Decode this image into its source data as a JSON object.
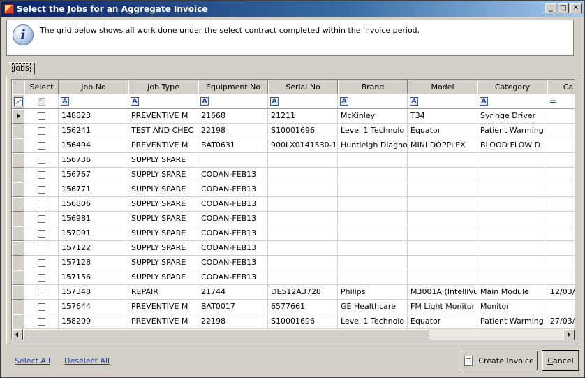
{
  "window": {
    "title": "Select the Jobs for an Aggregate Invoice",
    "controls": {
      "minimize": "_",
      "maximize": "□",
      "close": "✕"
    }
  },
  "info": {
    "icon": "info-icon",
    "text": "The grid below shows all work done under the select contract completed within the invoice period."
  },
  "tabs": [
    {
      "label": "Jobs"
    }
  ],
  "grid": {
    "columns": [
      "Select",
      "Job No",
      "Job Type",
      "Equipment No",
      "Serial No",
      "Brand",
      "Model",
      "Category",
      "Ca"
    ],
    "filter_operators": {
      "text": "A",
      "equals": "="
    },
    "rows": [
      {
        "current": true,
        "job_no": "148823",
        "job_type": "PREVENTIVE M",
        "equipment_no": "21668",
        "serial_no": "21211",
        "brand": "McKinley",
        "model": "T34",
        "category": "Syringe Driver",
        "ca": ""
      },
      {
        "current": false,
        "job_no": "156241",
        "job_type": "TEST AND CHEC",
        "equipment_no": "22198",
        "serial_no": "S10001696",
        "brand": "Level 1 Technolo",
        "model": "Equator",
        "category": "Patient Warming",
        "ca": ""
      },
      {
        "current": false,
        "job_no": "156494",
        "job_type": "PREVENTIVE M",
        "equipment_no": "BAT0631",
        "serial_no": "900LX0141530-1",
        "brand": "Huntleigh Diagno",
        "model": "MINI DOPPLEX",
        "category": "BLOOD FLOW D",
        "ca": ""
      },
      {
        "current": false,
        "job_no": "156736",
        "job_type": "SUPPLY SPARE",
        "equipment_no": "",
        "serial_no": "",
        "brand": "",
        "model": "",
        "category": "",
        "ca": ""
      },
      {
        "current": false,
        "job_no": "156767",
        "job_type": "SUPPLY SPARE",
        "equipment_no": "CODAN-FEB13",
        "serial_no": "",
        "brand": "",
        "model": "",
        "category": "",
        "ca": ""
      },
      {
        "current": false,
        "job_no": "156771",
        "job_type": "SUPPLY SPARE",
        "equipment_no": "CODAN-FEB13",
        "serial_no": "",
        "brand": "",
        "model": "",
        "category": "",
        "ca": ""
      },
      {
        "current": false,
        "job_no": "156806",
        "job_type": "SUPPLY SPARE",
        "equipment_no": "CODAN-FEB13",
        "serial_no": "",
        "brand": "",
        "model": "",
        "category": "",
        "ca": ""
      },
      {
        "current": false,
        "job_no": "156981",
        "job_type": "SUPPLY SPARE",
        "equipment_no": "CODAN-FEB13",
        "serial_no": "",
        "brand": "",
        "model": "",
        "category": "",
        "ca": ""
      },
      {
        "current": false,
        "job_no": "157091",
        "job_type": "SUPPLY SPARE",
        "equipment_no": "CODAN-FEB13",
        "serial_no": "",
        "brand": "",
        "model": "",
        "category": "",
        "ca": ""
      },
      {
        "current": false,
        "job_no": "157122",
        "job_type": "SUPPLY SPARE",
        "equipment_no": "CODAN-FEB13",
        "serial_no": "",
        "brand": "",
        "model": "",
        "category": "",
        "ca": ""
      },
      {
        "current": false,
        "job_no": "157128",
        "job_type": "SUPPLY SPARE",
        "equipment_no": "CODAN-FEB13",
        "serial_no": "",
        "brand": "",
        "model": "",
        "category": "",
        "ca": ""
      },
      {
        "current": false,
        "job_no": "157156",
        "job_type": "SUPPLY SPARE",
        "equipment_no": "CODAN-FEB13",
        "serial_no": "",
        "brand": "",
        "model": "",
        "category": "",
        "ca": ""
      },
      {
        "current": false,
        "job_no": "157348",
        "job_type": "REPAIR",
        "equipment_no": "21744",
        "serial_no": "DE512A3728",
        "brand": "Philips",
        "model": "M3001A (IntelliVu",
        "category": "Main Module",
        "ca": "12/03/"
      },
      {
        "current": false,
        "job_no": "157644",
        "job_type": "PREVENTIVE M",
        "equipment_no": "BAT0017",
        "serial_no": "6577661",
        "brand": "GE Healthcare",
        "model": "FM Light Monitor",
        "category": "Monitor",
        "ca": ""
      },
      {
        "current": false,
        "job_no": "158209",
        "job_type": "PREVENTIVE M",
        "equipment_no": "22198",
        "serial_no": "S10001696",
        "brand": "Level 1 Technolo",
        "model": "Equator",
        "category": "Patient Warming",
        "ca": "27/03/"
      }
    ]
  },
  "footer": {
    "select_all": "Select All",
    "deselect_all": "Deselect All",
    "create_invoice": "Create Invoice",
    "cancel": "Cancel"
  }
}
